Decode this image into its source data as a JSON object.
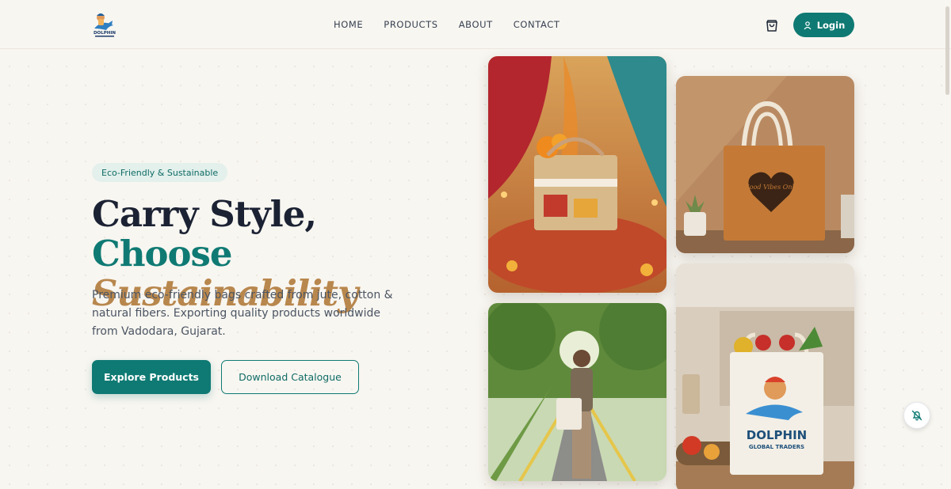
{
  "header": {
    "logo_text": "DOLPHIN",
    "nav": [
      "HOME",
      "PRODUCTS",
      "ABOUT",
      "CONTACT"
    ],
    "login_label": "Login"
  },
  "hero": {
    "badge": "Eco-Friendly & Sustainable",
    "headline_part1": "Carry Style, ",
    "headline_part2": "Choose",
    "headline_part3": "Sustainability",
    "description": "Premium eco-friendly bags crafted from jute, cotton & natural fibers. Exporting quality products worldwide from Vadodara, Gujarat.",
    "primary_button": "Explore Products",
    "secondary_button": "Download Catalogue"
  },
  "gallery": {
    "tote_text": "Good Vibes Only",
    "brand_bag_line1": "DOLPHIN",
    "brand_bag_line2": "GLOBAL TRADERS"
  },
  "colors": {
    "accent": "#0f7a73",
    "gold": "#b8874d",
    "background": "#f8f6f1",
    "heading": "#1b2233"
  },
  "icons": {
    "cart": "shopping-bag-icon",
    "login": "user-icon",
    "notification": "bell-off-icon"
  }
}
